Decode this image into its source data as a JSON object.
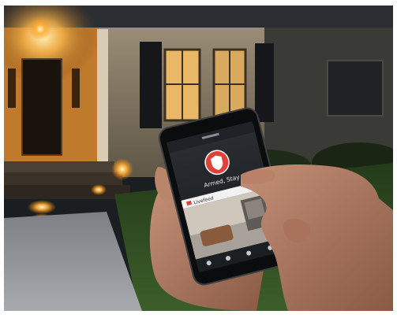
{
  "phone_screen": {
    "status_label": "Armed, Stay",
    "camera_label": "Livefeed"
  },
  "colors": {
    "alarm_red": "#e0413a",
    "porch_light": "#ffcf63",
    "window_glow": "#e9b766",
    "lawn_green": "#2f4e22"
  },
  "icons": {
    "shield": "shield-icon",
    "camera": "camera-icon",
    "nav": [
      "home-icon",
      "menu-icon",
      "settings-icon",
      "user-icon"
    ]
  }
}
